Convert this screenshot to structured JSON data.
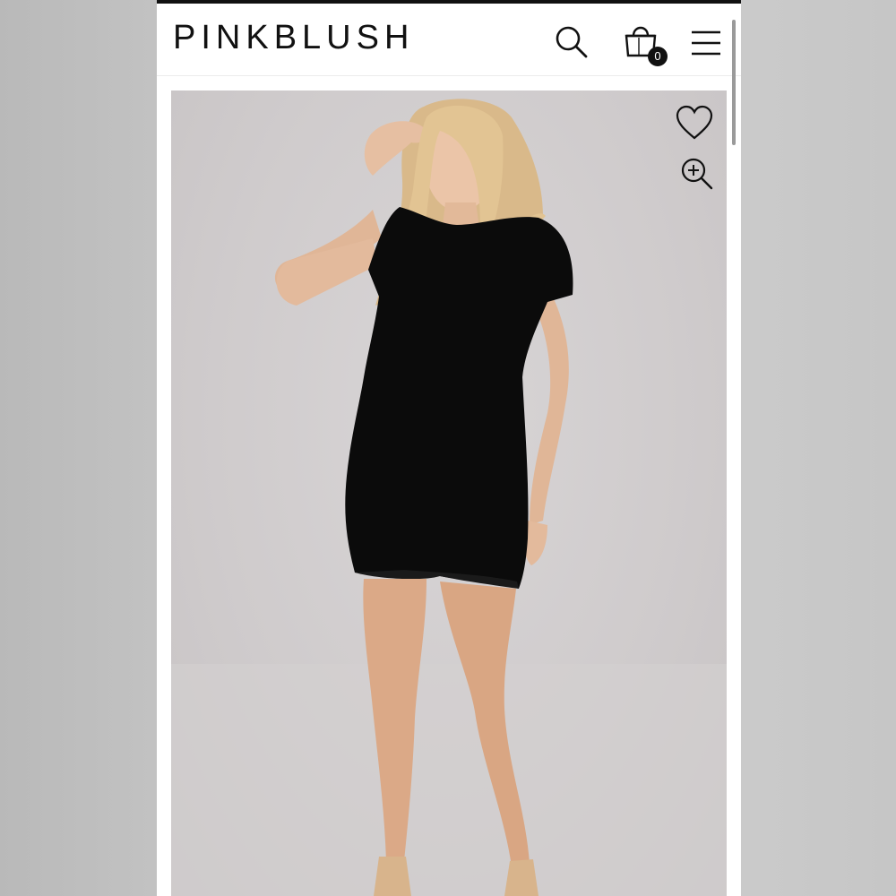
{
  "header": {
    "brand": "PINKBLUSH",
    "cart_count": "0"
  },
  "icons": {
    "search": "search-icon",
    "bag": "shopping-bag-icon",
    "menu": "hamburger-menu-icon",
    "wishlist": "heart-icon",
    "zoom": "zoom-in-icon"
  },
  "product_image": {
    "subject": "model-wearing-black-dress"
  },
  "colors": {
    "brand_text": "#111111",
    "background": "#ffffff",
    "dress": "#0b0b0b"
  }
}
